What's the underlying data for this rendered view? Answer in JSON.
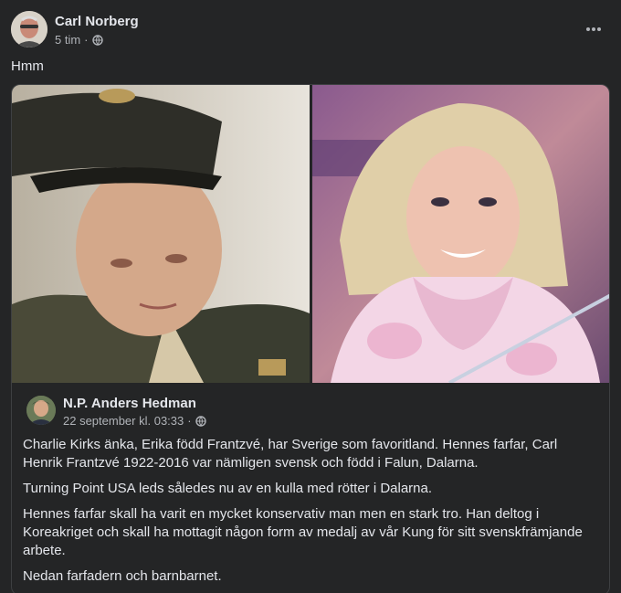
{
  "post": {
    "author": "Carl Norberg",
    "time": "5 tim",
    "separator": "·",
    "privacy_icon": "globe-icon",
    "more_icon": "more-horizontal-icon",
    "text": "Hmm"
  },
  "shared": {
    "author": "N.P. Anders Hedman",
    "time": "22 september kl. 03:33",
    "separator": "·",
    "privacy_icon": "globe-icon",
    "paragraphs": [
      "Charlie Kirks änka, Erika född Frantzvé, har Sverige som favoritland. Hennes farfar, Carl Henrik Frantzvé 1922-2016 var nämligen svensk och född i Falun, Dalarna.",
      "Turning Point USA leds således nu av en kulla med rötter i Dalarna.",
      "Hennes farfar skall ha varit en mycket konservativ man men en stark tro. Han deltog i Koreakriget och skall ha mottagit någon form av medalj av vår Kung för sitt svenskfrämjande arbete.",
      "Nedan farfadern och barnbarnet."
    ]
  },
  "colors": {
    "background": "#242526",
    "text_primary": "#e4e6eb",
    "text_secondary": "#b0b3b8",
    "border": "#3e4042"
  }
}
